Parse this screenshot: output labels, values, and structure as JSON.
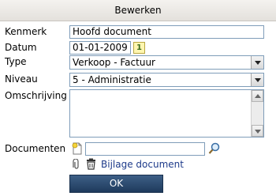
{
  "dialog": {
    "title": "Bewerken"
  },
  "form": {
    "kenmerk": {
      "label": "Kenmerk",
      "value": "Hoofd document"
    },
    "datum": {
      "label": "Datum",
      "value": "01-01-2009",
      "calendar_glyph": "1"
    },
    "type": {
      "label": "Type",
      "selected": "Verkoop - Factuur"
    },
    "niveau": {
      "label": "Niveau",
      "selected": "5 - Administratie"
    },
    "omschrijving": {
      "label": "Omschrijving",
      "value": ""
    },
    "documenten": {
      "label": "Documenten",
      "value": "",
      "link_label": "Bijlage document"
    }
  },
  "actions": {
    "ok_label": "OK"
  },
  "icons": {
    "new_document": "new-document-icon",
    "search": "search-icon",
    "attachment": "paperclip-icon",
    "delete": "trash-icon",
    "calendar": "calendar-icon"
  },
  "colors": {
    "button": "#2b4a6f",
    "link": "#1d3a8a",
    "border": "#7f9db9"
  }
}
